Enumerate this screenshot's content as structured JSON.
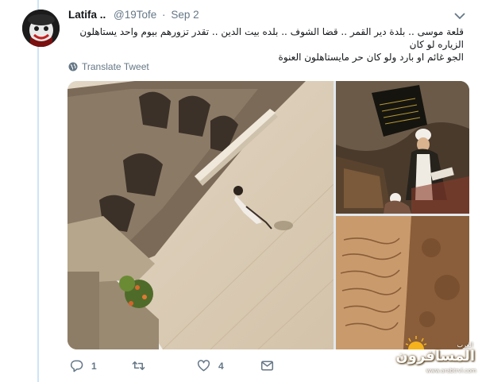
{
  "tweet": {
    "author_name": "Latifa ..",
    "author_handle": "@19Tofe",
    "separator": "·",
    "date": "Sep 2",
    "text_lines": [
      "قلعة موسى .. بلدة دير القمر .. قضا الشوف .. بلده بيت الدين .. تقدر تزورهم بيوم واحد يستاهلون الزياره لو كان",
      "الجو غائم او بارد ولو كان حر مايستاهلون العنوة"
    ],
    "translate_label": "Translate Tweet",
    "reply_count": "1",
    "retweet_count": "",
    "like_count": "4"
  },
  "watermark": {
    "top": "العرب",
    "main": "المسافرون",
    "url": "www.arabtrvl.com"
  },
  "icons": [
    "caret-down-icon",
    "globe-icon",
    "reply-icon",
    "retweet-icon",
    "like-icon",
    "message-icon"
  ],
  "colors": {
    "thread_line": "#cde6f5",
    "secondary_text": "#657786",
    "primary_text": "#14171a"
  }
}
